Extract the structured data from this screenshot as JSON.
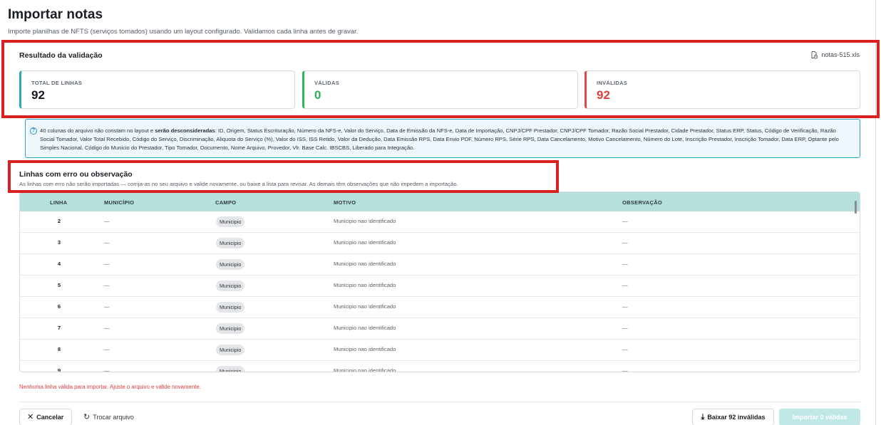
{
  "page": {
    "title": "Importar notas",
    "subtitle": "Importe planilhas de NFTS (serviços tomados) usando um layout configurado. Validamos cada linha antes de gravar."
  },
  "validation": {
    "title": "Resultado da validação",
    "file_name": "notas-515.xls",
    "stats": {
      "total_label": "TOTAL DE LINHAS",
      "total_value": "92",
      "valid_label": "VÁLIDAS",
      "valid_value": "0",
      "invalid_label": "INVÁLIDAS",
      "invalid_value": "92"
    }
  },
  "info": {
    "prefix": "40 colunas do arquivo não constam no layout e ",
    "emphasis": "serão desconsideradas",
    "columns": ": ID, Origem, Status Escrituração, Número da NFS-e, Valor do Serviço, Data de Emissão da NFS-e, Data de Importação, CNPJ/CPF Prestador, CNPJ/CPF Tomador, Razão Social Prestador, Cidade Prestador, Status ERP, Status, Código de Verificação, Razão Social Tomador, Valor Total Recebido, Código do Serviço, Discriminação, Aliquota do Serviço (%), Valor do ISS, ISS Retido, Valor da Dedução, Data Emissão RPS, Data Envio PDF, Número RPS, Série RPS, Data Cancelamento, Motivo Cancelamento, Número do Lote, Inscrição Prestador, Inscrição Tomador, Data ERP, Optante pelo Simples Nacional, Código do Municio do Prestador, Tipo Tomador, Documento, Nome Arquivo, Provedor, Vlr. Base Calc. IBSCBS, Liberado para Integração."
  },
  "errors": {
    "title": "Linhas com erro ou observação",
    "subtitle": "As linhas com erro não serão importadas — corrija-as no seu arquivo e valide novamente, ou baixe a lista para revisar. As demais têm observações que não impedem a importação."
  },
  "table": {
    "headers": {
      "linha": "LINHA",
      "municipio": "MUNICÍPIO",
      "campo": "CAMPO",
      "motivo": "MOTIVO",
      "observacao": "OBSERVAÇÃO"
    },
    "rows": [
      {
        "linha": "2",
        "municipio": "—",
        "campo": "Municipio",
        "motivo": "Municipio nao identificado",
        "observacao": "—"
      },
      {
        "linha": "3",
        "municipio": "—",
        "campo": "Municipio",
        "motivo": "Municipio nao identificado",
        "observacao": "—"
      },
      {
        "linha": "4",
        "municipio": "—",
        "campo": "Municipio",
        "motivo": "Municipio nao identificado",
        "observacao": "—"
      },
      {
        "linha": "5",
        "municipio": "—",
        "campo": "Municipio",
        "motivo": "Municipio nao identificado",
        "observacao": "—"
      },
      {
        "linha": "6",
        "municipio": "—",
        "campo": "Municipio",
        "motivo": "Municipio nao identificado",
        "observacao": "—"
      },
      {
        "linha": "7",
        "municipio": "—",
        "campo": "Municipio",
        "motivo": "Municipio nao identificado",
        "observacao": "—"
      },
      {
        "linha": "8",
        "municipio": "—",
        "campo": "Municipio",
        "motivo": "Municipio nao identificado",
        "observacao": "—"
      },
      {
        "linha": "9",
        "municipio": "—",
        "campo": "Municipio",
        "motivo": "Municipio nao identificado",
        "observacao": "—"
      }
    ]
  },
  "footer": {
    "warning": "Nenhuma linha válida para importar. Ajuste o arquivo e valide novamente.",
    "cancel_label": "Cancelar",
    "swap_label": "Trocar arquivo",
    "download_label": "Baixar 92 inválidas",
    "import_label": "Importar 0 válidas"
  },
  "icons": {
    "close": "close-icon",
    "refresh": "refresh-icon",
    "download": "download-icon",
    "info": "info-icon",
    "file": "file-sync-icon"
  },
  "colors": {
    "accent": "#2aa7c4",
    "valid": "#27b04f",
    "invalid": "#e23d3d",
    "table_header": "#b5e0dc",
    "highlight": "#d92121"
  }
}
